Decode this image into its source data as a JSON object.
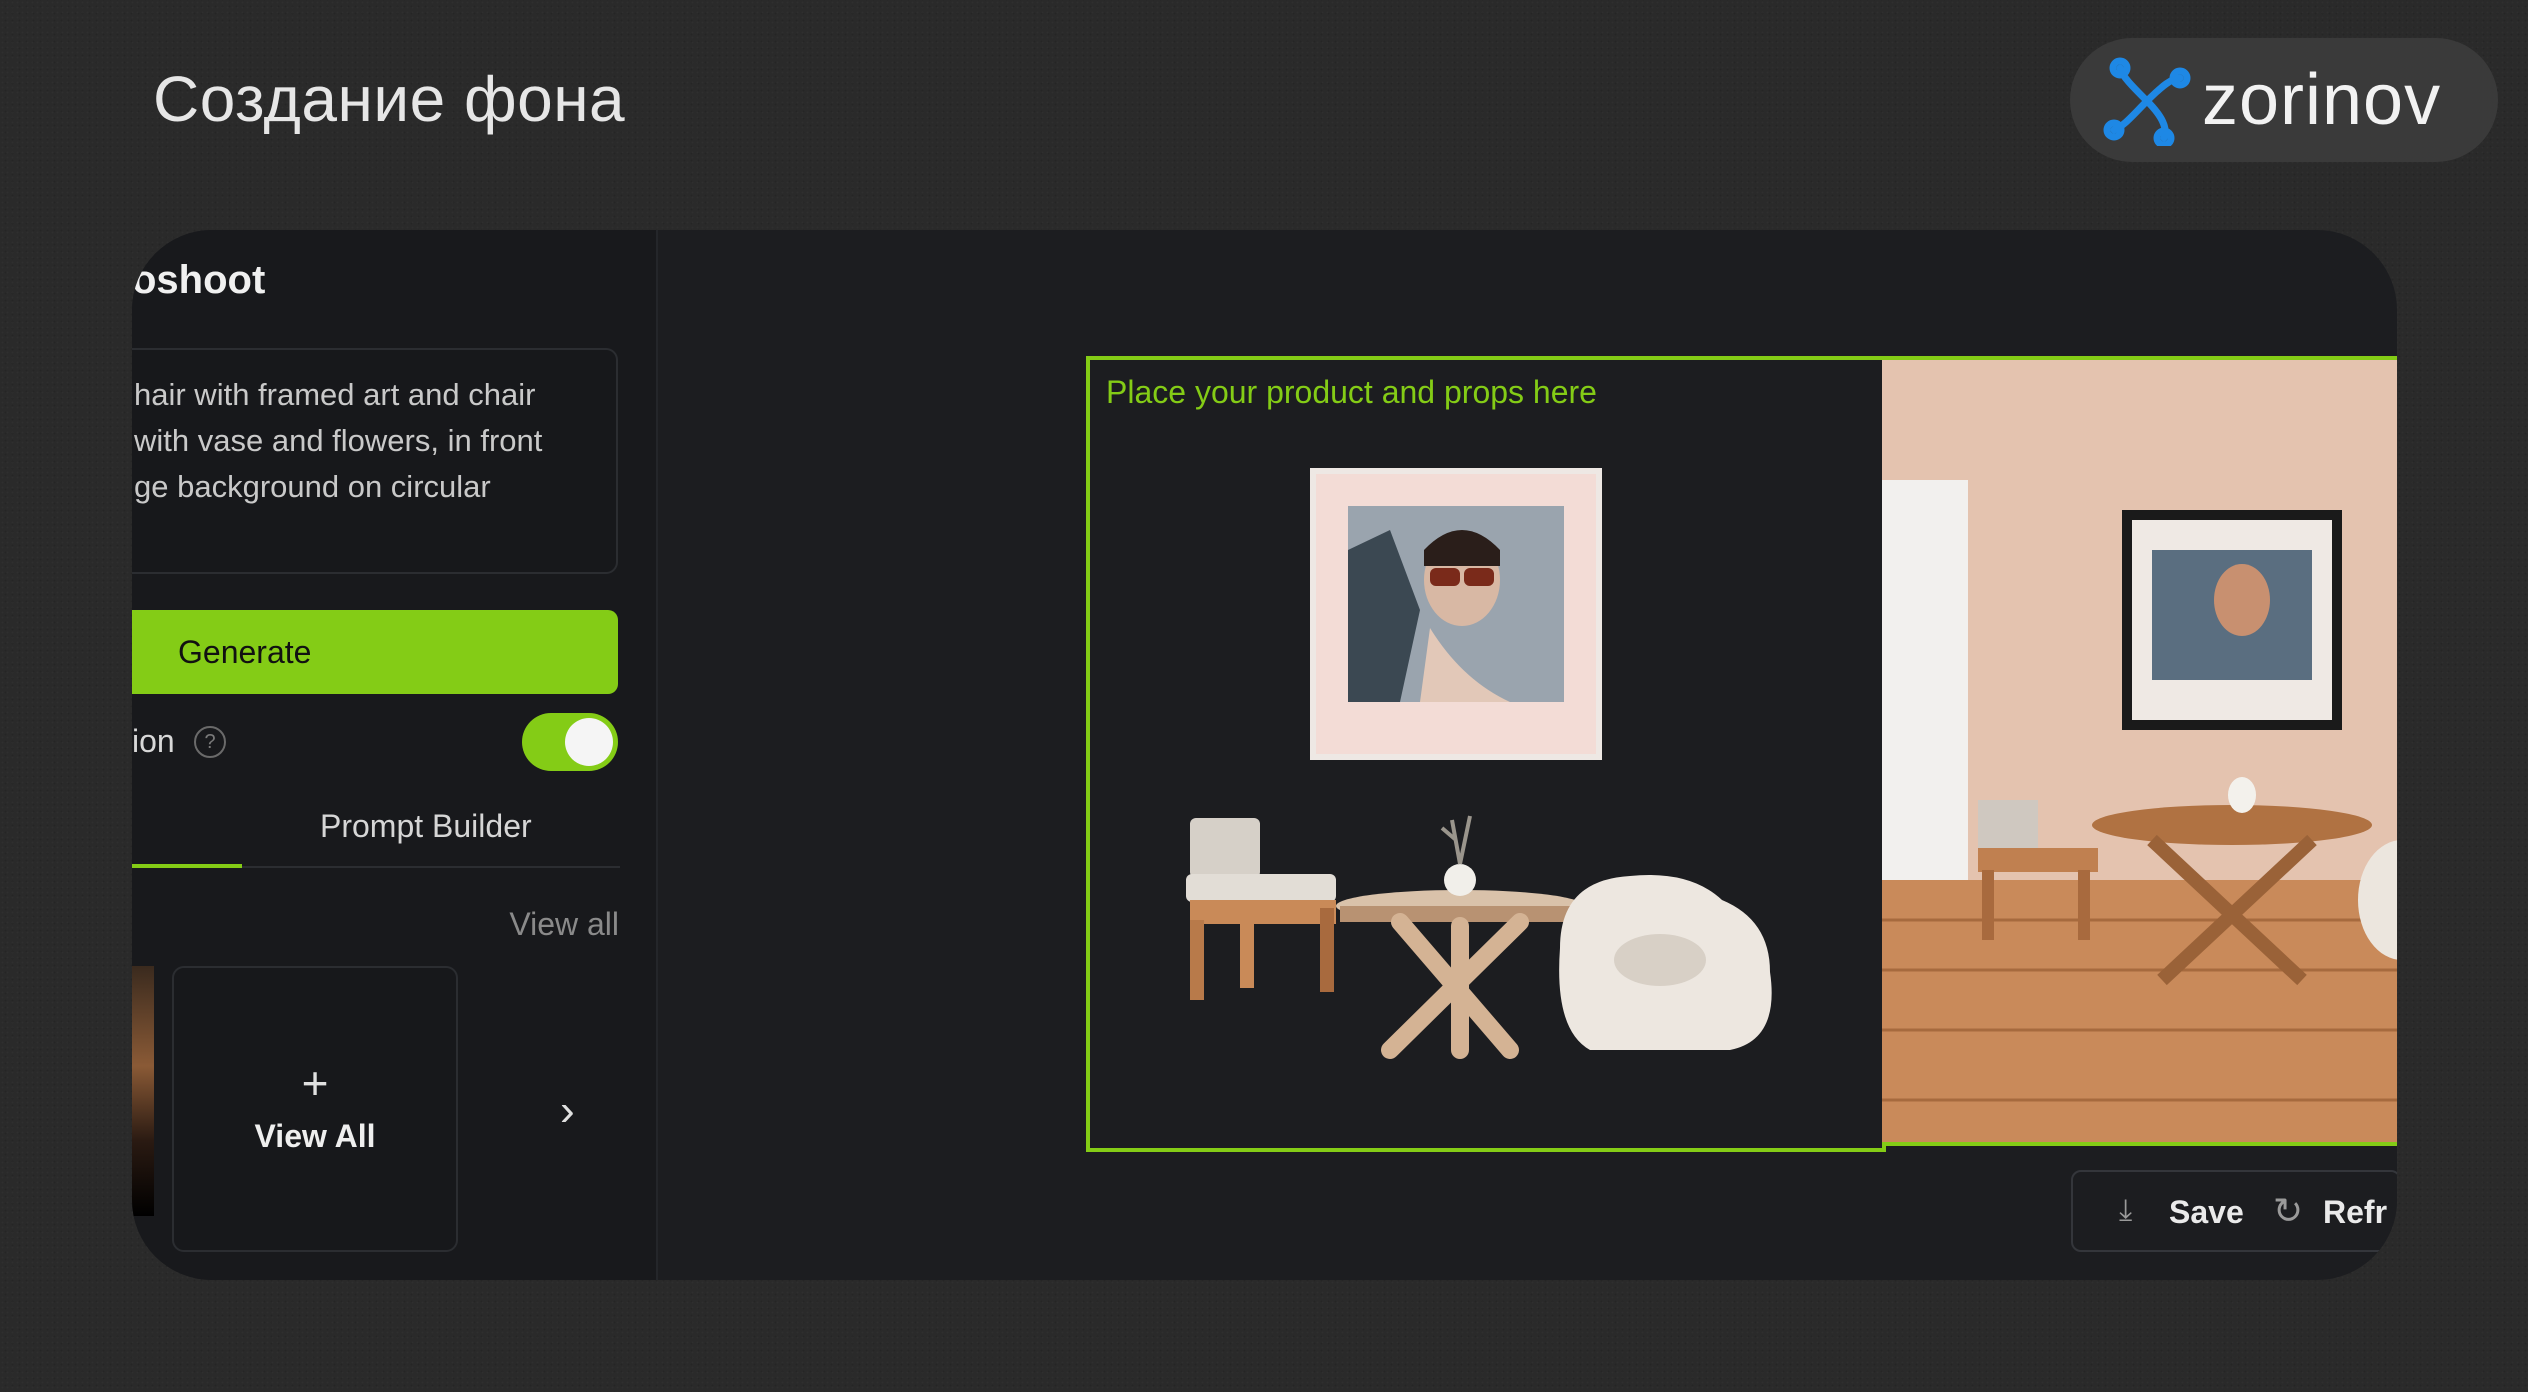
{
  "header": {
    "title": "Создание фона"
  },
  "brand": {
    "name": "zorinov",
    "accent_color": "#1e88e5"
  },
  "sidebar": {
    "title": "oshoot",
    "prompt_text": "hair with framed art and chair\nwith vase and flowers, in front\nge background on circular",
    "generate_label": "Generate",
    "option_label": "ion",
    "option_enabled": true,
    "tabs": [
      "",
      "Prompt Builder"
    ],
    "view_all_link": "View all",
    "view_all_card_icon": "+",
    "view_all_card_label": "View All",
    "next_icon": "chevron-right-icon"
  },
  "canvas": {
    "hint": "Place your product and props here"
  },
  "actions": {
    "save_label": "Save",
    "refresh_label": "Refr"
  },
  "colors": {
    "accent": "#84cc16",
    "panel": "#1c1d20",
    "background": "#2a2a2a"
  }
}
